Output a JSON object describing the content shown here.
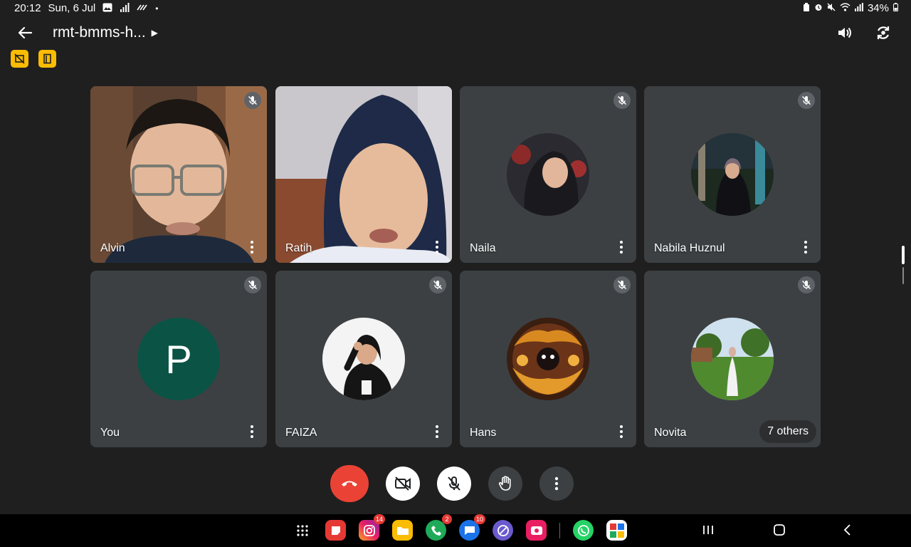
{
  "status_bar": {
    "time": "20:12",
    "date": "Sun, 6 Jul",
    "battery": "34%"
  },
  "header": {
    "meeting_title": "rmt-bmms-h..."
  },
  "participants": [
    {
      "name": "Alvin",
      "type": "video",
      "active_speaker": true,
      "muted": true
    },
    {
      "name": "Ratih",
      "type": "video",
      "active_speaker": false,
      "muted": false
    },
    {
      "name": "Naila",
      "type": "photo",
      "muted": true
    },
    {
      "name": "Nabila Huznul",
      "type": "photo",
      "muted": true
    },
    {
      "name": "You",
      "type": "letter",
      "letter": "P",
      "avatar_color": "#0b5345",
      "muted": true
    },
    {
      "name": "FAIZA",
      "type": "photo",
      "muted": true
    },
    {
      "name": "Hans",
      "type": "photo",
      "muted": true
    },
    {
      "name": "Novita",
      "type": "photo",
      "muted": true
    }
  ],
  "others_chip": "7 others",
  "controls": [
    "end-call",
    "camera-off",
    "mic-off",
    "raise-hand",
    "more-options"
  ],
  "dock": {
    "apps": [
      {
        "name": "app-drawer"
      },
      {
        "name": "notes-app",
        "color": "#e53935"
      },
      {
        "name": "instagram",
        "badge": "14"
      },
      {
        "name": "files",
        "color": "#fbbc04"
      },
      {
        "name": "phone",
        "color": "#1faa59",
        "badge": "2"
      },
      {
        "name": "messages",
        "color": "#1a73e8",
        "badge": "10"
      },
      {
        "name": "browser",
        "color": "#6a5acd"
      },
      {
        "name": "screen-recorder",
        "color": "#e91e63"
      },
      {
        "name": "whatsapp",
        "color": "#25d366"
      },
      {
        "name": "office",
        "color": "#e53935"
      }
    ]
  },
  "colors": {
    "background": "#1f1f1f",
    "tile": "#3c4043",
    "accent": "#4a6fd8",
    "end_call": "#ea4335",
    "chip": "#fbbc04"
  }
}
